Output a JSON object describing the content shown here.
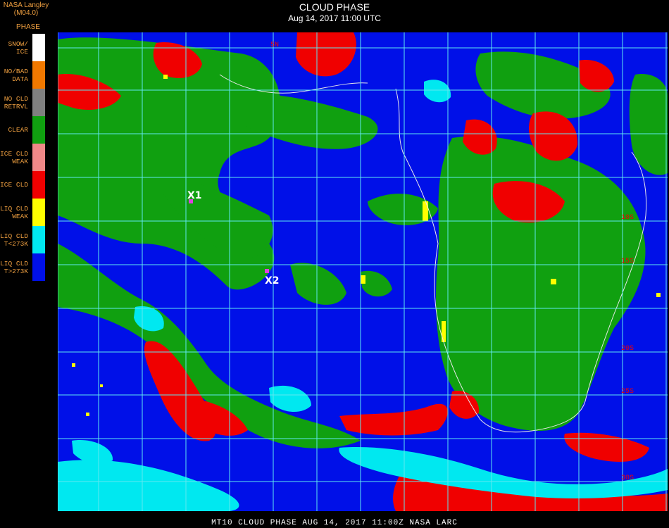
{
  "header": {
    "title": "CLOUD PHASE",
    "datetime": "Aug 14, 2017 11:00 UTC"
  },
  "legend": {
    "source": "NASA Langley (M04.0)",
    "heading": "PHASE",
    "items": [
      {
        "label": "SNOW/\nICE",
        "color": "#ffffff"
      },
      {
        "label": "NO/BAD\nDATA",
        "color": "#f07800"
      },
      {
        "label": "NO CLD\nRETRVL",
        "color": "#808080"
      },
      {
        "label": "CLEAR",
        "color": "#10a010"
      },
      {
        "label": "ICE CLD\nWEAK",
        "color": "#f08888"
      },
      {
        "label": "ICE CLD",
        "color": "#f00000"
      },
      {
        "label": "LIQ CLD\nWEAK",
        "color": "#ffff00"
      },
      {
        "label": "LIQ CLD\nT<273K",
        "color": "#00e8f0"
      },
      {
        "label": "LIQ CLD\nT>273K",
        "color": "#0010e8"
      }
    ]
  },
  "map": {
    "markers": [
      {
        "label": "X1"
      },
      {
        "label": "X2"
      }
    ],
    "lat_labels": [
      "5N",
      "10S",
      "15S",
      "20S",
      "25S",
      "30S"
    ],
    "colors": {
      "ocean": "#0010e8",
      "clear": "#10a010",
      "ice": "#f00000",
      "liq_cold": "#00e8f0",
      "liq_weak": "#ffff00",
      "grid": "#60e8f0",
      "marker": "#e040e0"
    }
  },
  "footer": {
    "text": "MT10  CLOUD PHASE   AUG 14, 2017 11:00Z   NASA LARC"
  }
}
